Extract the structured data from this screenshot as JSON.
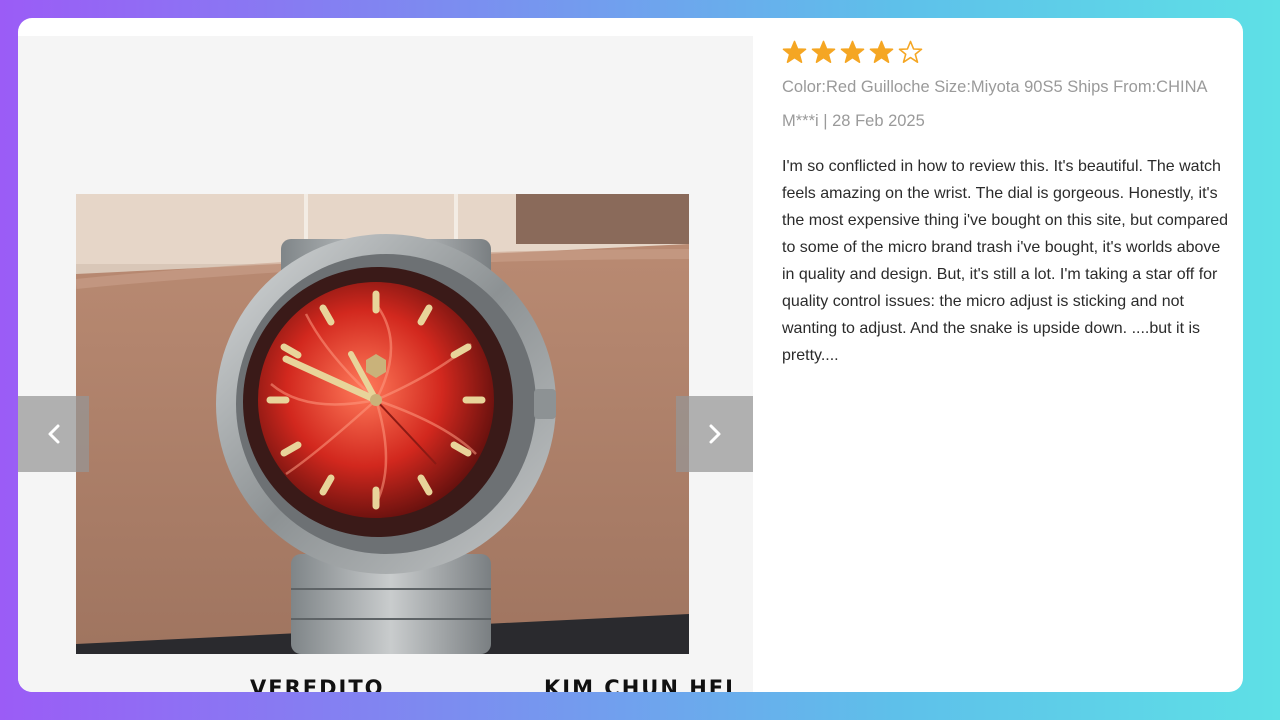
{
  "review": {
    "rating": 4,
    "rating_max": 5,
    "star_color": "#f5a623",
    "meta_line": "Color:Red Guilloche Size:Miyota 90S5 Ships From:CHINA",
    "author_date": "M***i | 28 Feb 2025",
    "text": "I'm so conflicted in how to review this. It's beautiful. The watch feels amazing on the wrist. The dial is gorgeous. Honestly, it's the most expensive thing i've bought on this site, but compared to some of the micro brand trash i've bought, it's worlds above in quality and design. But, it's still a lot. I'm taking a star off for quality control issues: the micro adjust is sticking and not wanting to adjust. And the snake is upside down. ....but it is pretty...."
  },
  "gallery": {
    "prev_icon": "chevron-left-icon",
    "next_icon": "chevron-right-icon"
  },
  "captions": {
    "left": "VEREDITO",
    "right": "KIM CHUN HEI"
  }
}
